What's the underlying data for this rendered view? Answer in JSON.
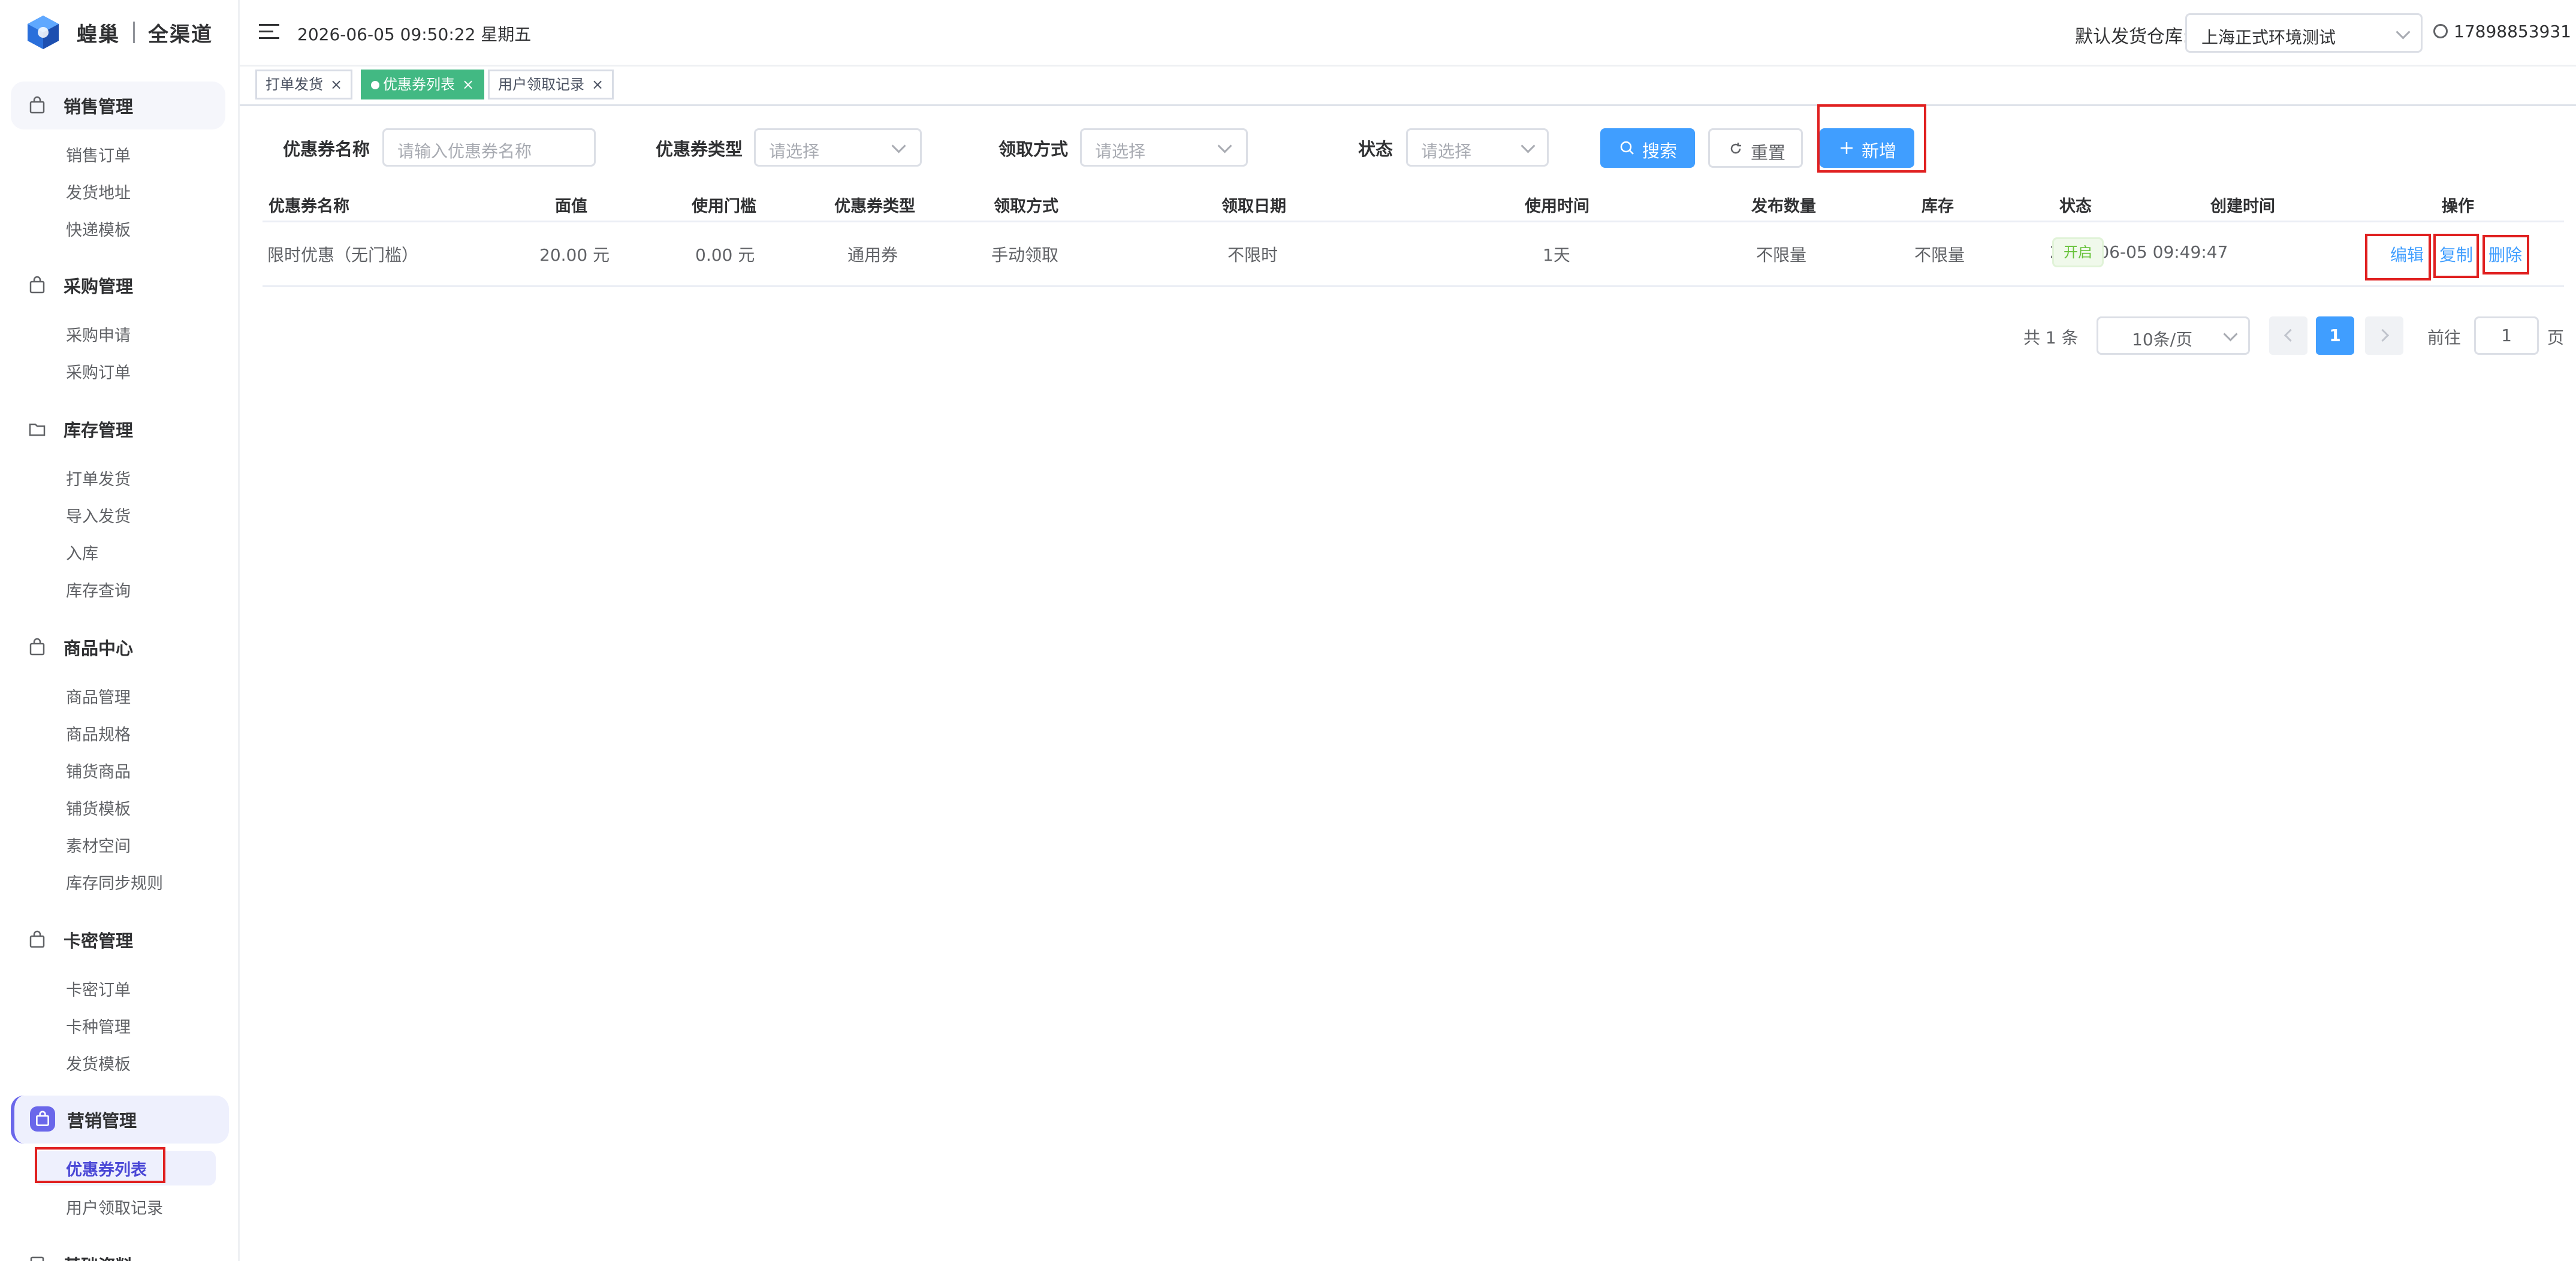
{
  "brand": {
    "name": "蝗巢",
    "sub": "全渠道"
  },
  "sidebar": {
    "groups": [
      {
        "label": "销售管理",
        "items": [
          "销售订单",
          "发货地址",
          "快递模板"
        ]
      },
      {
        "label": "采购管理",
        "items": [
          "采购申请",
          "采购订单"
        ]
      },
      {
        "label": "库存管理",
        "items": [
          "打单发货",
          "导入发货",
          "入库",
          "库存查询"
        ]
      },
      {
        "label": "商品中心",
        "items": [
          "商品管理",
          "商品规格",
          "铺货商品",
          "铺货模板",
          "素材空间",
          "库存同步规则"
        ]
      },
      {
        "label": "卡密管理",
        "items": [
          "卡密订单",
          "卡种管理",
          "发货模板"
        ]
      },
      {
        "label": "营销管理",
        "items": [
          "优惠券列表",
          "用户领取记录"
        ]
      },
      {
        "label": "基础资料",
        "items": []
      }
    ]
  },
  "header": {
    "datetime": "2026-06-05 09:50:22 星期五",
    "warehouse_label": "默认发货仓库:",
    "warehouse_value": "上海正式环境测试",
    "user": "17898853931"
  },
  "tabs": [
    {
      "label": "打单发货",
      "active": false
    },
    {
      "label": "优惠券列表",
      "active": true
    },
    {
      "label": "用户领取记录",
      "active": false
    }
  ],
  "filters": {
    "name_label": "优惠券名称",
    "name_placeholder": "请输入优惠券名称",
    "type_label": "优惠券类型",
    "type_placeholder": "请选择",
    "method_label": "领取方式",
    "method_placeholder": "请选择",
    "status_label": "状态",
    "status_placeholder": "请选择",
    "search_btn": "搜索",
    "reset_btn": "重置",
    "add_btn": "新增"
  },
  "table": {
    "columns": [
      "优惠券名称",
      "面值",
      "使用门槛",
      "优惠券类型",
      "领取方式",
      "领取日期",
      "使用时间",
      "发布数量",
      "库存",
      "状态",
      "创建时间",
      "操作"
    ],
    "rows": [
      {
        "name": "限时优惠（无门槛）",
        "value": "20.00 元",
        "threshold": "0.00 元",
        "type": "通用券",
        "method": "手动领取",
        "date": "不限时",
        "use_time": "1天",
        "publish": "不限量",
        "stock": "不限量",
        "status": "开启",
        "created": "2026-06-05 09:49:47",
        "actions": [
          "编辑",
          "复制",
          "删除"
        ]
      }
    ]
  },
  "pagination": {
    "total": "共 1 条",
    "page_size": "10条/页",
    "current": "1",
    "goto_label": "前往",
    "goto_value": "1",
    "page_suffix": "页"
  },
  "colors": {
    "primary": "#409eff",
    "accent": "#6a67ea",
    "tab_active": "#42b983",
    "highlight_box": "#e02020"
  }
}
